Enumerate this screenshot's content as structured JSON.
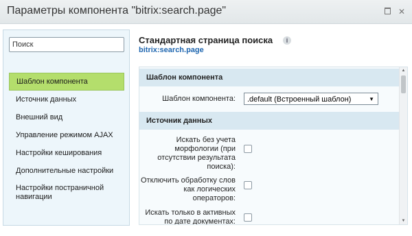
{
  "window": {
    "title": "Параметры компонента \"bitrix:search.page\""
  },
  "sidebar": {
    "search_placeholder": "Поиск",
    "items": [
      {
        "label": "Шаблон компонента",
        "active": true
      },
      {
        "label": "Источник данных"
      },
      {
        "label": "Внешний вид"
      },
      {
        "label": "Управление режимом AJAX"
      },
      {
        "label": "Настройки кеширования"
      },
      {
        "label": "Дополнительные настройки"
      },
      {
        "label": "Настройки постраничной навигации"
      }
    ]
  },
  "main": {
    "title": "Стандартная страница поиска",
    "subtitle": "bitrix:search.page",
    "info_icon": "i"
  },
  "sections": {
    "template": {
      "header": "Шаблон компонента",
      "field_label": "Шаблон компонента:",
      "select_value": ".default (Встроенный шаблон)"
    },
    "source": {
      "header": "Источник данных",
      "fields": [
        {
          "label": "Искать без учета морфологии (при отсутствии результата поиска):",
          "checked": false
        },
        {
          "label": "Отключить обработку слов как логических операторов:",
          "checked": false
        },
        {
          "label": "Искать только в активных по дате документах:",
          "checked": false
        }
      ]
    }
  },
  "icons": {
    "maximize": "maximize-icon",
    "close": "close-icon",
    "info": "info-icon",
    "select_arrow": "chevron-down-icon"
  },
  "colors": {
    "active_nav": "#b4de6c",
    "section_header": "#d8e8f1",
    "link": "#2067b0"
  }
}
